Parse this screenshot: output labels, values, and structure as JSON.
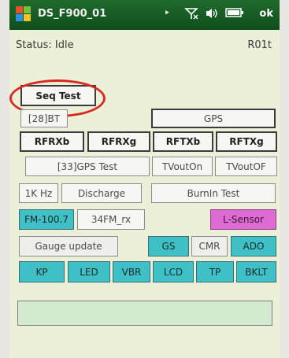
{
  "titlebar": {
    "title": "DS_F900_01",
    "ok_label": "ok"
  },
  "status": {
    "label": "Status: Idle",
    "version": "R01t"
  },
  "buttons": {
    "seq_test": "Seq Test",
    "bt": "[28]BT",
    "gps": "GPS",
    "rfrxb": "RFRXb",
    "rfrxg": "RFRXg",
    "rftxb": "RFTXb",
    "rftxg": "RFTXg",
    "gps_test": "[33]GPS Test",
    "tvout_on": "TVoutOn",
    "tvout_of": "TVoutOF",
    "one_khz": "1K Hz",
    "discharge": "Discharge",
    "burnin_test": "BurnIn Test",
    "fm_100_7": "FM-100.7",
    "fm_34_rx": "34FM_rx",
    "l_sensor": "L-Sensor",
    "gauge_update": "Gauge update",
    "gs": "GS",
    "cmr": "CMR",
    "ado": "ADO",
    "kp": "KP",
    "led": "LED",
    "vbr": "VBR",
    "lcd": "LCD",
    "tp": "TP",
    "bklt": "BKLT"
  },
  "output": {
    "value": ""
  },
  "colors": {
    "titlebar": "#1f6a2c",
    "client_bg": "#ecf0d8",
    "cyan_button": "#3ec0c6",
    "pink_button": "#de6ad3",
    "highlight_circle": "#d72a22",
    "output_box": "#d2ead0"
  },
  "icons": {
    "start": "windows-flag-icon",
    "connectivity": "person-icon",
    "signal": "signal-off-icon",
    "volume": "speaker-icon",
    "battery": "battery-icon"
  }
}
